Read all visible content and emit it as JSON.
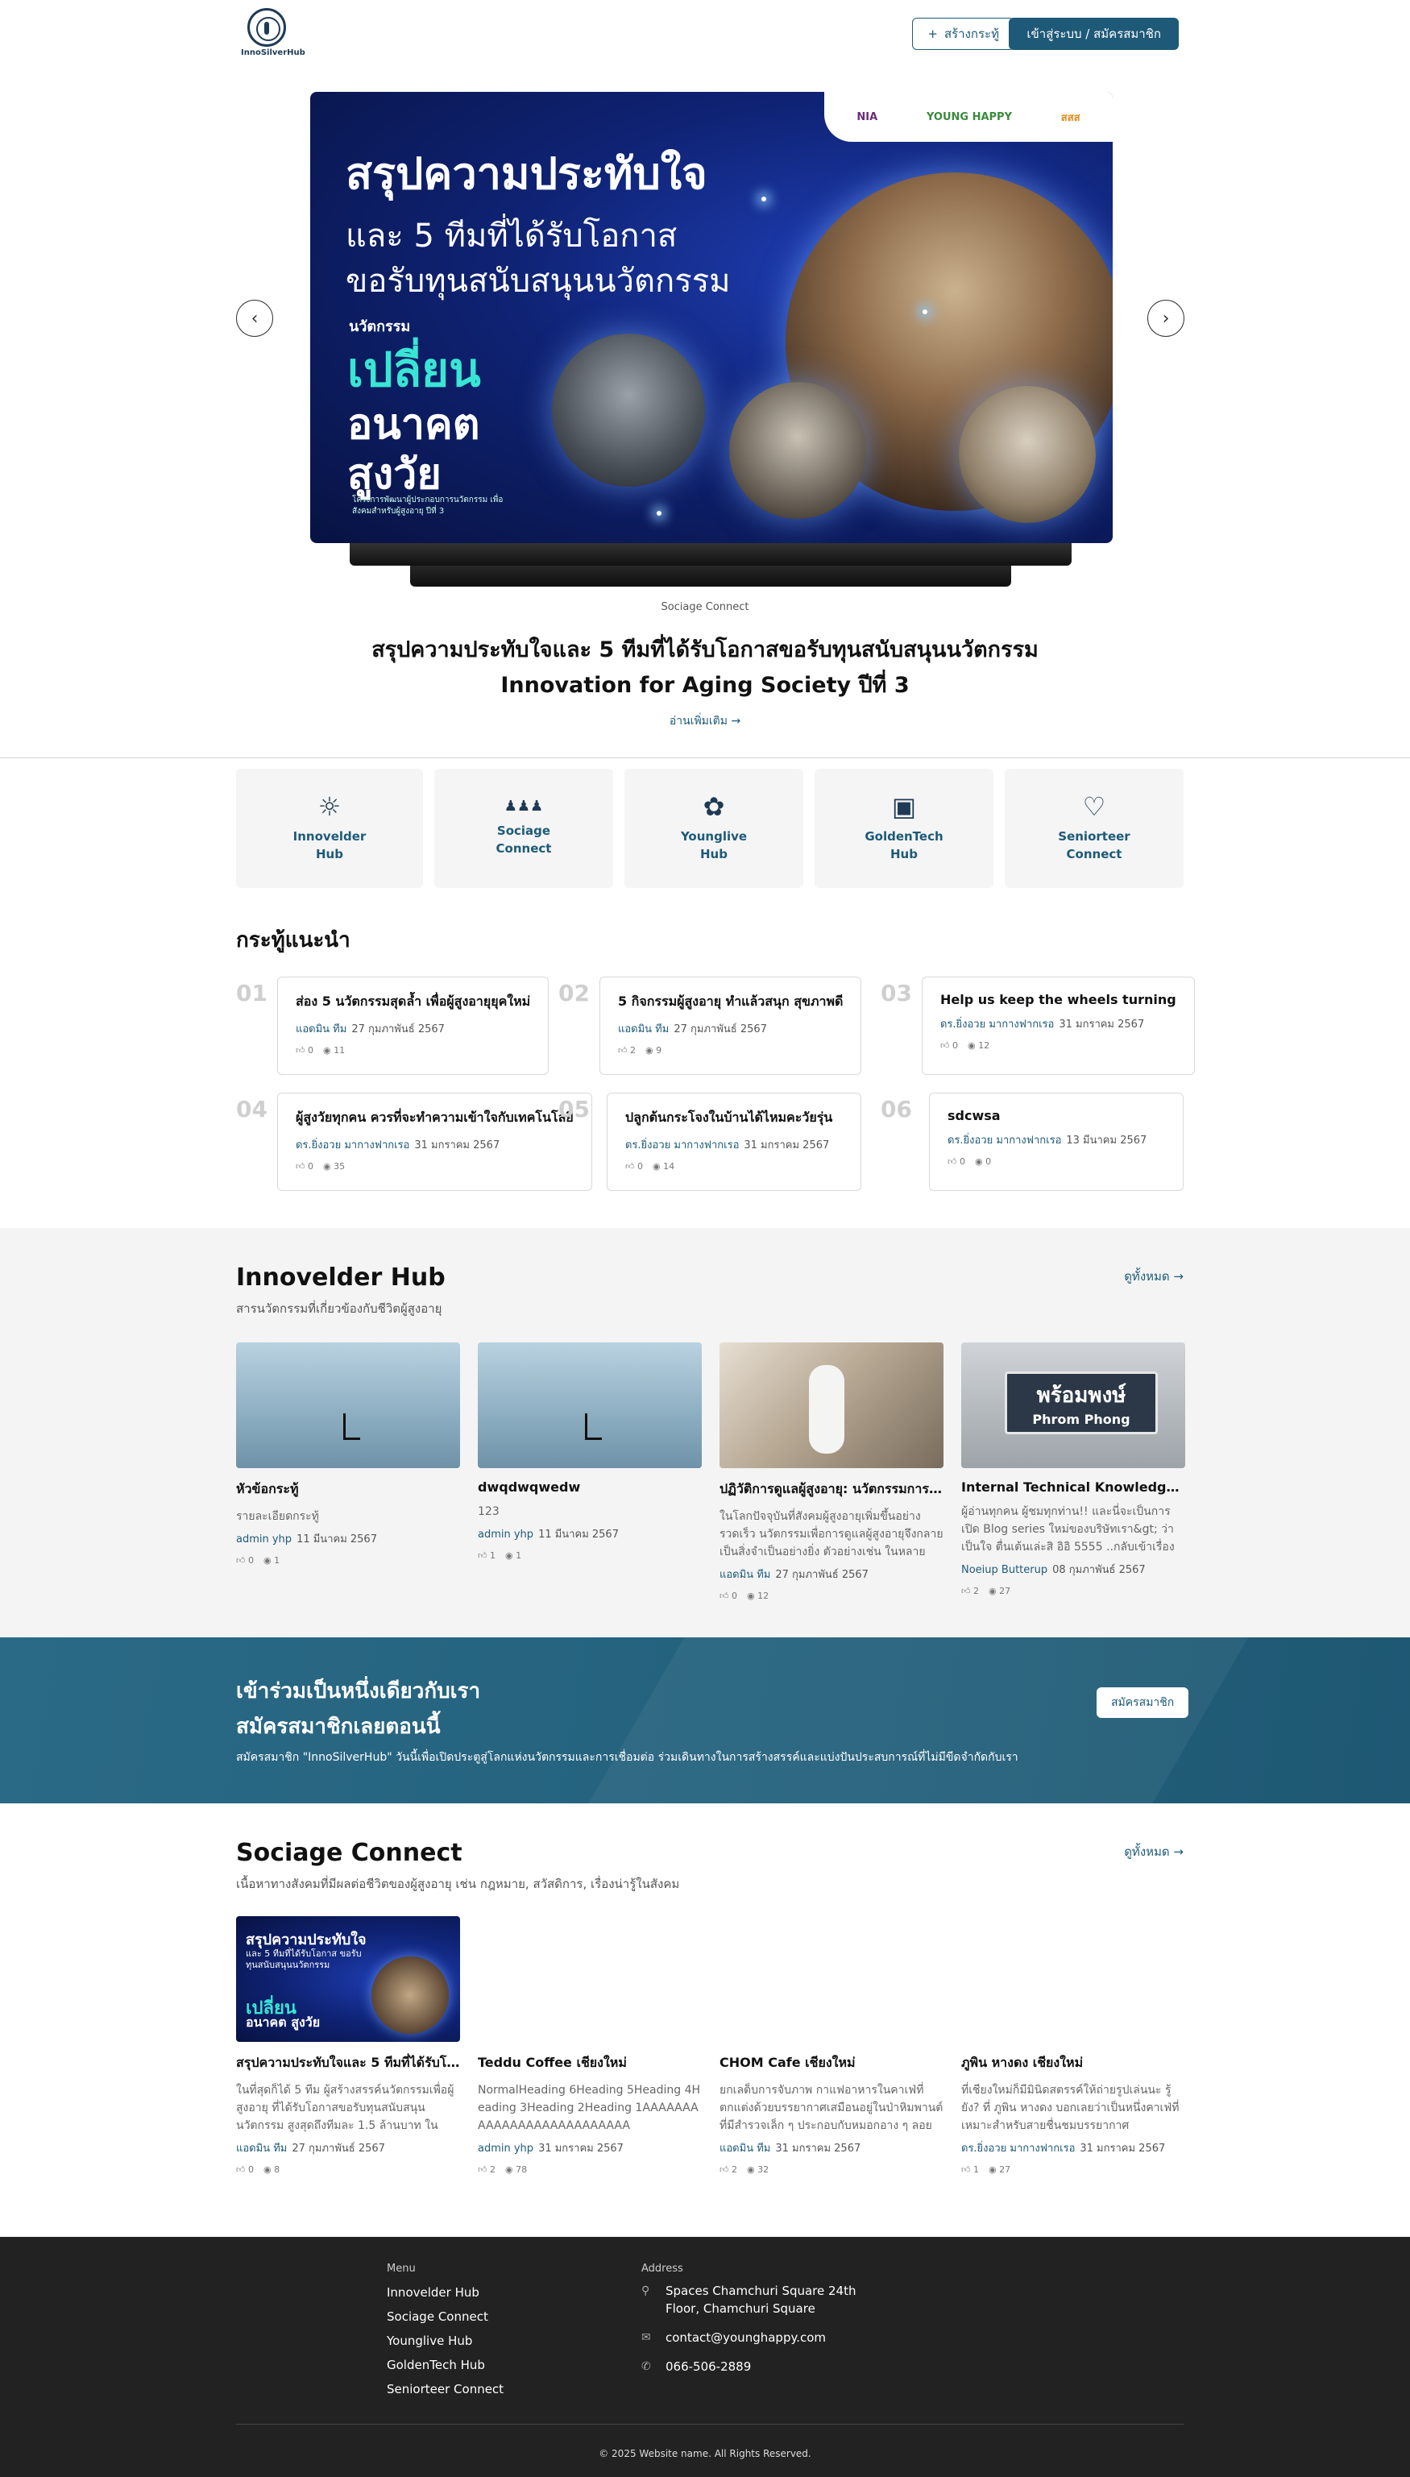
{
  "header": {
    "logo_text": "InnoSilverHub",
    "create_button": "สร้างกระทู้",
    "login_button": "เข้าสู่ระบบ / สมัครสมาชิก"
  },
  "hero": {
    "slide": {
      "logos": [
        "NIA",
        "YOUNG HAPPY",
        "สสส"
      ],
      "headline": "สรุปความประทับใจ",
      "line2": "และ 5 ทีมที่ได้รับโอกาส",
      "line3": "ขอรับทุนสนับสนุนนวัตกรรม",
      "tag": "นวัตกรรม",
      "big1": "เปลี่ยน",
      "big2": "อนาคต",
      "big3": "สูงวัย",
      "small": "โครงการพัฒนาผู้ประกอบการนวัตกรรม เพื่อสังคมสำหรับผู้สูงอายุ ปีที่ 3"
    },
    "source": "Sociage Connect",
    "title_line1": "สรุปความประทับใจและ 5 ทีมที่ได้รับโอกาสขอรับทุนสนับสนุนนวัตกรรม",
    "title_line2": "Innovation for Aging Society ปีที่ 3",
    "read_more": "อ่านเพิ่มเติม →"
  },
  "hubs": [
    {
      "label": "Innovelder Hub",
      "icon": "lightbulb-icon",
      "glyph": "☼"
    },
    {
      "label": "Sociage Connect",
      "icon": "people-group-icon",
      "glyph": "♟♟♟"
    },
    {
      "label": "Younglive Hub",
      "icon": "plant-icon",
      "glyph": "✿"
    },
    {
      "label": "GoldenTech Hub",
      "icon": "monitor-icon",
      "glyph": "▣"
    },
    {
      "label": "Seniorteer Connect",
      "icon": "hand-heart-icon",
      "glyph": "♡"
    }
  ],
  "recommended": {
    "title": "กระทู้แนะนำ",
    "items": [
      {
        "num": "01",
        "title": "ส่อง 5 นวัตกรรมสุดล้ำ เพื่อผู้สูงอายุยุคใหม่",
        "author": "แอดมิน ทีม",
        "date": "27 กุมภาพันธ์ 2567",
        "likes": "0",
        "views": "11"
      },
      {
        "num": "02",
        "title": "5 กิจกรรมผู้สูงอายุ ทำแล้วสนุก สุขภาพดี",
        "author": "แอดมิน ทีม",
        "date": "27 กุมภาพันธ์ 2567",
        "likes": "2",
        "views": "9"
      },
      {
        "num": "03",
        "title": "Help us keep the wheels turning",
        "author": "ดร.ยิ่งอวย มากางฟากเรอ",
        "date": "31 มกราคม 2567",
        "likes": "0",
        "views": "12"
      },
      {
        "num": "04",
        "title": "ผู้สูงวัยทุกคน ควรที่จะทำความเข้าใจกับเทคโนโลยี",
        "author": "ดร.ยิ่งอวย มากางฟากเรอ",
        "date": "31 มกราคม 2567",
        "likes": "0",
        "views": "35"
      },
      {
        "num": "05",
        "title": "ปลูกต้นกระโจงในบ้านได้ไหมคะวัยรุ่น",
        "author": "ดร.ยิ่งอวย มากางฟากเรอ",
        "date": "31 มกราคม 2567",
        "likes": "0",
        "views": "14"
      },
      {
        "num": "06",
        "title": "sdcwsa",
        "author": "ดร.ยิ่งอวย มากางฟากเรอ",
        "date": "13 มีนาคม 2567",
        "likes": "0",
        "views": "0"
      }
    ]
  },
  "innovelder": {
    "title": "Innovelder Hub",
    "subtitle": "สารนวัตกรรมที่เกี่ยวข้องกับชีวิตผู้สูงอายุ",
    "see_all": "ดูทั้งหมด →",
    "cards": [
      {
        "title": "หัวข้อกระทู้",
        "desc": "รายละเอียดกระทู้",
        "author": "admin yhp",
        "date": "11 มีนาคม 2567",
        "likes": "0",
        "views": "1",
        "image": "mist-chair"
      },
      {
        "title": "dwqdwqwedw",
        "desc": "123",
        "author": "admin yhp",
        "date": "11 มีนาคม 2567",
        "likes": "1",
        "views": "1",
        "image": "mist-chair"
      },
      {
        "title": "ปฏิวัติการดูแลผู้สูงอายุ: นวัตกรรมการดูแลผู้สูงอายุ",
        "desc": "ในโลกปัจจุบันที่สังคมผู้สูงอายุเพิ่มขึ้นอย่างรวดเร็ว นวัตกรรมเพื่อการดูแลผู้สูงอายุจึงกลายเป็นสิ่งจำเป็นอย่างยิ่ง ตัวอย่างเช่น ในหลายประเทศ",
        "author": "แอดมิน ทีม",
        "date": "27 กุมภาพันธ์ 2567",
        "likes": "0",
        "views": "12",
        "image": "robot"
      },
      {
        "title": "Internal Technical Knowledge sharing",
        "desc": "ผู้อ่านทุกคน ผู้ชมทุกท่าน!! และนี่จะเป็นการเปิด Blog series ใหม่ของบริษัทเรา&gt; ว่าเป็นใจ ตื่นเต้นเล่ะสิ อิอิ 5555 ..กลับเข้าเรื่องกัน",
        "author": "Noeiup Butterup",
        "date": "08 กุมภาพันธ์ 2567",
        "likes": "2",
        "views": "27",
        "image": "station"
      }
    ],
    "station_sign_th": "พร้อมพงษ์",
    "station_sign_en": "Phrom Phong"
  },
  "join": {
    "line1": "เข้าร่วมเป็นหนึ่งเดียวกับเรา",
    "line2": "สมัครสมาชิกเลยตอนนี้",
    "sub": "สมัครสมาชิก \"InnoSilverHub\" วันนี้เพื่อเปิดประตูสู่โลกแห่งนวัตกรรมและการเชื่อมต่อ ร่วมเดินทางในการสร้างสรรค์และแบ่งปันประสบการณ์ที่ไม่มีขีดจำกัดกับเรา",
    "button": "สมัครสมาชิก"
  },
  "sociage": {
    "title": "Sociage Connect",
    "subtitle": "เนื้อหาทางสังคมที่มีผลต่อชีวิตของผู้สูงอายุ เช่น กฎหมาย, สวัสดิการ, เรื่องน่ารู้ในสังคม",
    "see_all": "ดูทั้งหมด →",
    "cards": [
      {
        "title": "สรุปความประทับใจและ 5 ทีมที่ได้รับโอกาส",
        "desc": "ในที่สุดก็ได้ 5 ทีม ผู้สร้างสรรค์นวัตกรรมเพื่อผู้สูงอายุ ที่ได้รับโอกาสขอรับทุนสนับสนุนนวัตกรรม สูงสุดถึงทีมละ 1.5 ล้านบาท ใน",
        "author": "แอดมิน ทีม",
        "date": "27 กุมภาพันธ์ 2567",
        "likes": "0",
        "views": "8",
        "image": "sociage"
      },
      {
        "title": "Teddu Coffee เชียงใหม่",
        "desc": "NormalHeading 6Heading 5Heading 4Heading 3Heading 2Heading 1AAAAAAAAAAAAAAAAAAAAAAAAAA",
        "author": "admin yhp",
        "date": "31 มกราคม 2567",
        "likes": "2",
        "views": "78",
        "image": "blank"
      },
      {
        "title": "CHOM Cafe เชียงใหม่",
        "desc": "ยกเลต็บการจับภาพ กาแฟอาหารในคาเฟ่ที่ตกแต่งด้วยบรรยากาศเสมือนอยู่ในป่าหิมพานต์ ที่มีสำรวจเล็ก ๆ ประกอบกับหมอกอาง ๆ ลอย",
        "author": "แอดมิน ทีม",
        "date": "31 มกราคม 2567",
        "likes": "2",
        "views": "32",
        "image": "blank"
      },
      {
        "title": "ภูพิน หางดง เชียงใหม่",
        "desc": "ที่เชียงใหม่ก็มีมินิดสตรรค์ให้ถ่ายรูปเล่นนะ รู้ยัง? ที่ ภูพิน หางดง บอกเลยว่าเป็นหนึ่งคาเฟ่ที่เหมาะสำหรับสายชื่นชมบรรยากาศ",
        "author": "ดร.ยิ่งอวย มากางฟากเรอ",
        "date": "31 มกราคม 2567",
        "likes": "1",
        "views": "27",
        "image": "blank"
      }
    ],
    "card_image_text": {
      "t1": "สรุปความประทับใจ",
      "t2": "และ 5 ทีมที่ได้รับโอกาส ขอรับทุนสนับสนุนนวัตกรรม",
      "t3": "เปลี่ยน",
      "t4": "อนาคต สูงวัย"
    }
  },
  "footer": {
    "menu_heading": "Menu",
    "menu": [
      "Innovelder Hub",
      "Sociage Connect",
      "Younglive Hub",
      "GoldenTech Hub",
      "Seniorteer Connect"
    ],
    "address_heading": "Address",
    "address": "Spaces Chamchuri Square 24th Floor, Chamchuri Square",
    "email": "contact@younghappy.com",
    "phone": "066-506-2889",
    "copyright": "© 2025 Website name. All Rights Reserved."
  }
}
